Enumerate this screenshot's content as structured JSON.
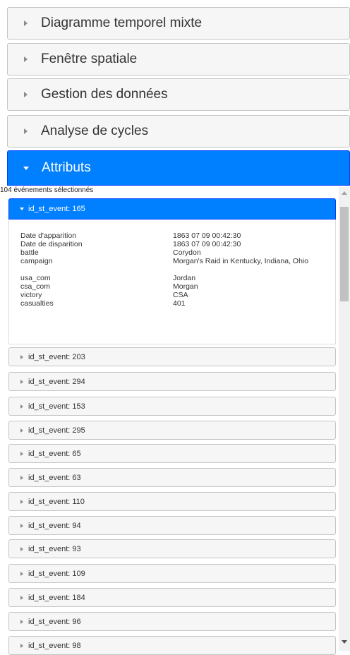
{
  "accordion": [
    {
      "label": "Diagramme temporel mixte"
    },
    {
      "label": "Fenêtre spatiale"
    },
    {
      "label": "Gestion des données"
    },
    {
      "label": "Analyse de cycles"
    }
  ],
  "attributes_panel": {
    "label": "Attributs",
    "selected_count_text": "104 événements sélectionnés"
  },
  "expanded_event": {
    "label": "id_st_event: 165",
    "attributes": [
      {
        "key": "Date d'apparition",
        "value": "1863 07 09 00:42:30"
      },
      {
        "key": "Date de disparition",
        "value": "1863 07 09 00:42:30"
      },
      {
        "key": "battle",
        "value": "Corydon"
      },
      {
        "key": "campaign",
        "value": "Morgan's Raid in Kentucky, Indiana, Ohio"
      },
      {
        "key": "usa_com",
        "value": "Jordan"
      },
      {
        "key": "csa_com",
        "value": "Morgan"
      },
      {
        "key": "victory",
        "value": "CSA"
      },
      {
        "key": "casualties",
        "value": "401"
      }
    ]
  },
  "events": [
    {
      "label": "id_st_event: 203"
    },
    {
      "label": "id_st_event: 294"
    },
    {
      "label": "id_st_event: 153"
    },
    {
      "label": "id_st_event: 295"
    },
    {
      "label": "id_st_event: 65"
    },
    {
      "label": "id_st_event: 63"
    },
    {
      "label": "id_st_event: 110"
    },
    {
      "label": "id_st_event: 94"
    },
    {
      "label": "id_st_event: 93"
    },
    {
      "label": "id_st_event: 109"
    },
    {
      "label": "id_st_event: 184"
    },
    {
      "label": "id_st_event: 96"
    },
    {
      "label": "id_st_event: 98"
    }
  ]
}
